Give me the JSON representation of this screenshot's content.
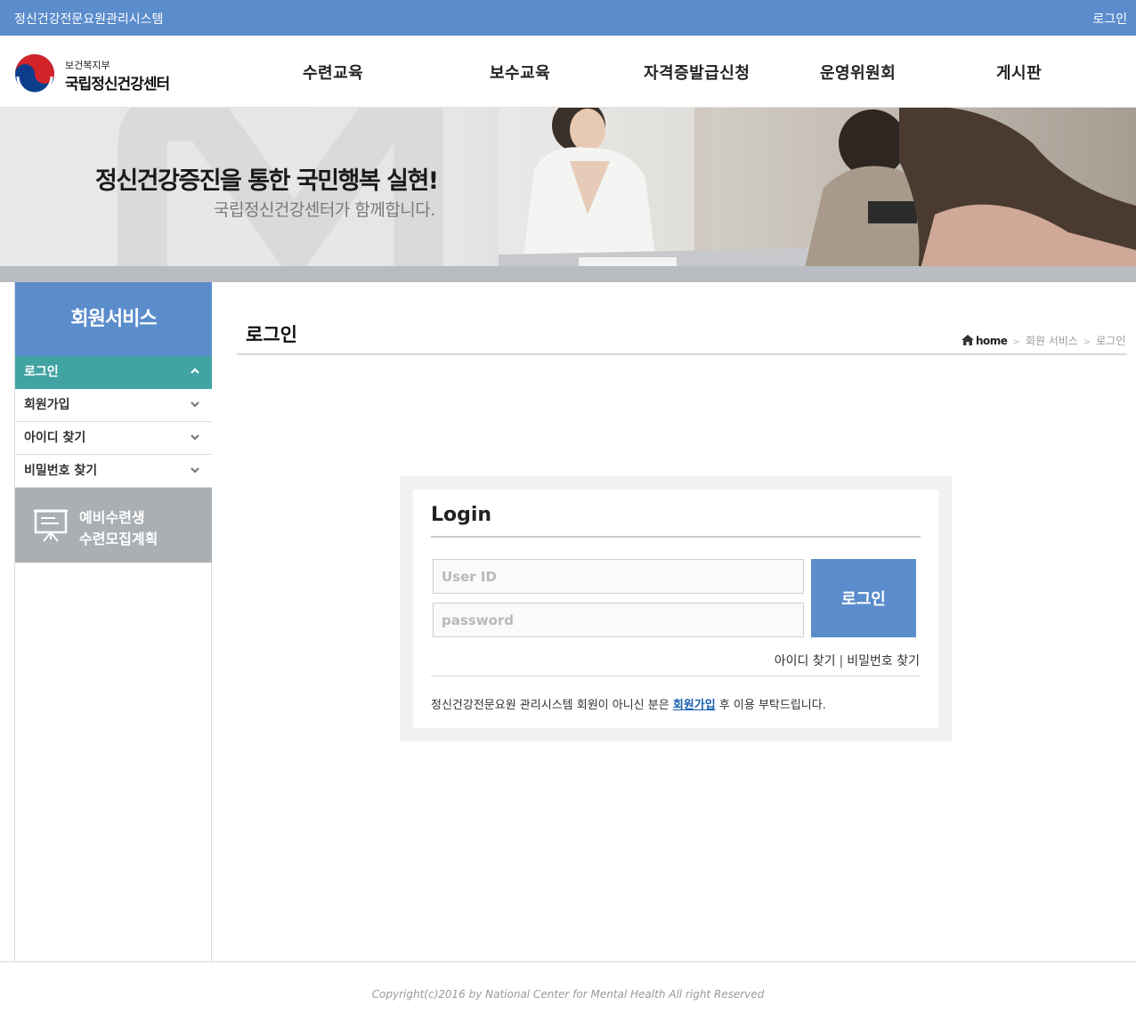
{
  "topbar": {
    "system_name": "정신건강전문요원관리시스템",
    "login_label": "로그인"
  },
  "header": {
    "ministry": "보건복지부",
    "center": "국립정신건강센터",
    "nav": [
      "수련교육",
      "보수교육",
      "자격증발급신청",
      "운영위원회",
      "게시판"
    ]
  },
  "banner": {
    "headline": "정신건강증진을 통한 국민행복 실현!",
    "subline": "국립정신건강센터가 함께합니다."
  },
  "sidebar": {
    "title": "회원서비스",
    "items": [
      {
        "label": "로그인",
        "active": true
      },
      {
        "label": "회원가입",
        "active": false
      },
      {
        "label": "아이디 찾기",
        "active": false
      },
      {
        "label": "비밀번호 찾기",
        "active": false
      }
    ],
    "promo": {
      "line1": "예비수련생",
      "line2": "수련모집계획"
    }
  },
  "content": {
    "title": "로그인",
    "breadcrumb": [
      "home",
      "회원 서비스",
      "로그인"
    ]
  },
  "login": {
    "heading": "Login",
    "user_placeholder": "User ID",
    "password_placeholder": "password",
    "button": "로그인",
    "find_id": "아이디 찾기",
    "separator": "|",
    "find_password": "비밀번호 찾기",
    "notice_before": "정신건강전문요원 관리시스템 회원이 아니신 분은 ",
    "notice_link": "회원가입",
    "notice_after": " 후 이용 부탁드립니다."
  },
  "footer": {
    "copyright": "Copyright(c)2016 by National Center for Mental Health All right Reserved"
  },
  "colors": {
    "primary": "#5b8ccc",
    "active_menu": "#42a3a3",
    "promo": "#a9afb3"
  }
}
